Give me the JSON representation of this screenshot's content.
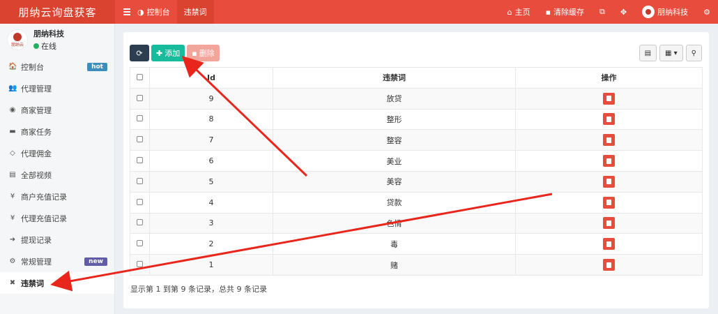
{
  "brand": {
    "title": "朋纳云询盘获客"
  },
  "topnav": {
    "items": [
      {
        "label": "控制台",
        "active": false
      },
      {
        "label": "违禁词",
        "active": true
      }
    ]
  },
  "topright": {
    "home": "主页",
    "clear_cache": "清除缓存",
    "username": "朋纳科技"
  },
  "user": {
    "name": "朋纳科技",
    "status": "在线",
    "logo_text": "朋纳云"
  },
  "sidebar": {
    "items": [
      {
        "label": "控制台",
        "icon": "dashboard-icon",
        "glyph": "🏠",
        "badge": "hot",
        "badge_color": "#3c8dbc"
      },
      {
        "label": "代理管理",
        "icon": "users-icon",
        "glyph": "👥"
      },
      {
        "label": "商家管理",
        "icon": "eye-icon",
        "glyph": "◉"
      },
      {
        "label": "商家任务",
        "icon": "keyboard-icon",
        "glyph": "▬"
      },
      {
        "label": "代理佣金",
        "icon": "diamond-icon",
        "glyph": "◇"
      },
      {
        "label": "全部视频",
        "icon": "file-icon",
        "glyph": "▤"
      },
      {
        "label": "商户充值记录",
        "icon": "yen-icon",
        "glyph": "¥"
      },
      {
        "label": "代理充值记录",
        "icon": "yen-icon",
        "glyph": "¥"
      },
      {
        "label": "提现记录",
        "icon": "sign-in-icon",
        "glyph": "➜"
      },
      {
        "label": "常规管理",
        "icon": "gears-icon",
        "glyph": "⚙",
        "badge": "new",
        "badge_color": "#605ca8"
      },
      {
        "label": "违禁词",
        "icon": "close-icon",
        "glyph": "✖",
        "active": true
      }
    ]
  },
  "toolbar": {
    "add_label": "添加",
    "delete_label": "删除"
  },
  "table": {
    "headers": [
      "Id",
      "违禁词",
      "操作"
    ],
    "rows": [
      {
        "id": "9",
        "word": "放贷"
      },
      {
        "id": "8",
        "word": "整形"
      },
      {
        "id": "7",
        "word": "整容"
      },
      {
        "id": "6",
        "word": "美业"
      },
      {
        "id": "5",
        "word": "美容"
      },
      {
        "id": "4",
        "word": "贷款"
      },
      {
        "id": "3",
        "word": "色情"
      },
      {
        "id": "2",
        "word": "毒"
      },
      {
        "id": "1",
        "word": "赌"
      }
    ]
  },
  "footer": {
    "info": "显示第 1 到第 9 条记录，总共 9 条记录"
  },
  "colors": {
    "header": "#e74c3c",
    "add": "#18bc9c",
    "annotation": "#e8261c"
  }
}
